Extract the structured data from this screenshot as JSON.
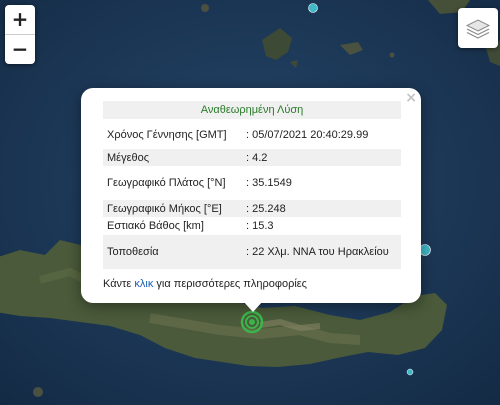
{
  "map": {
    "marker_color": "#3bb44a",
    "dot_color": "#3fb8c8",
    "controls": {
      "zoom_in": "+",
      "zoom_out": "−",
      "layers_icon": "layers-icon"
    }
  },
  "popup": {
    "title": "Αναθεωρημένη Λύση",
    "close": "×",
    "rows": [
      {
        "label": "Χρόνος Γέννησης [GMT]",
        "value": ": 05/07/2021 20:40:29.99"
      },
      {
        "label": "Μέγεθος",
        "value": ": 4.2"
      },
      {
        "label": "Γεωγραφικό Πλάτος [°N]",
        "value": ": 35.1549"
      },
      {
        "label": "Γεωγραφικό Μήκος [°E]",
        "value": ": 25.248"
      },
      {
        "label": "Εστιακό Βάθος [km]",
        "value": ": 15.3"
      },
      {
        "label": "Τοποθεσία",
        "value": ": 22 Χλμ. ΝΝΑ του Ηρακλείου"
      }
    ],
    "more_prefix": "Κάντε ",
    "more_link": "κλικ",
    "more_suffix": " για περισσότερες πληροφορίες"
  }
}
